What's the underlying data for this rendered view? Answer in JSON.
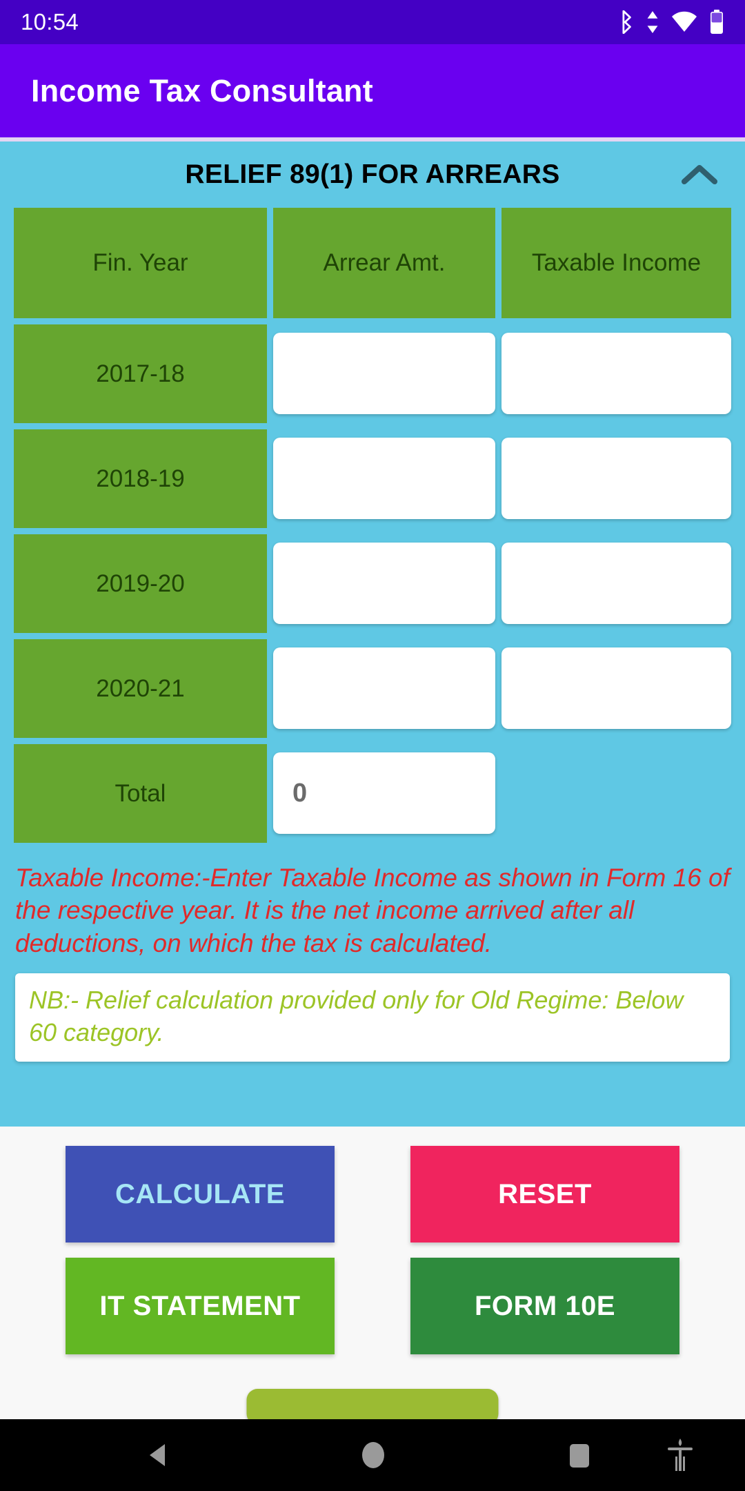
{
  "status_bar": {
    "time": "10:54",
    "icons": [
      "bluetooth-icon",
      "data-transfer-icon",
      "wifi-icon",
      "battery-icon"
    ]
  },
  "app_bar": {
    "title": "Income Tax Consultant"
  },
  "section": {
    "title": "RELIEF 89(1) FOR ARREARS",
    "collapse_icon": "chevron-up-icon"
  },
  "table": {
    "headers": [
      "Fin. Year",
      "Arrear Amt.",
      "Taxable Income"
    ],
    "rows": [
      {
        "year": "2017-18",
        "arrear": "",
        "taxable": ""
      },
      {
        "year": "2018-19",
        "arrear": "",
        "taxable": ""
      },
      {
        "year": "2019-20",
        "arrear": "",
        "taxable": ""
      },
      {
        "year": "2020-21",
        "arrear": "",
        "taxable": ""
      }
    ],
    "total": {
      "label": "Total",
      "arrear": "0"
    }
  },
  "notes": {
    "red": "Taxable Income:-Enter Taxable Income as shown in Form 16 of the respective year. It is the net income arrived after all deductions, on which the tax is calculated.",
    "green": "NB:- Relief calculation provided only for Old Regime: Below 60 category."
  },
  "buttons": {
    "calculate": "CALCULATE",
    "reset": "RESET",
    "it_statement": "IT STATEMENT",
    "form_10e": "FORM 10E"
  },
  "nav_bar": {
    "back": "back-icon",
    "home": "home-icon",
    "recents": "recents-icon",
    "accessibility": "accessibility-icon"
  },
  "colors": {
    "status_bar": "#4400C4",
    "app_bar": "#6A00F0",
    "panel": "#5FC8E4",
    "green_cell": "#66A62F",
    "note_red": "#E02A2A",
    "note_green": "#9CC426",
    "calculate": "#3F51B5",
    "reset": "#F0245E",
    "it_statement": "#62B723",
    "form_10e": "#2E8B3D"
  }
}
